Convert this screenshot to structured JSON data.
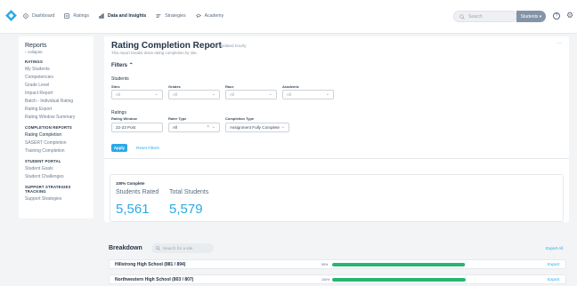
{
  "nav": {
    "items": [
      {
        "label": "Dashboard",
        "icon": "home-icon"
      },
      {
        "label": "Ratings",
        "icon": "ratings-icon"
      },
      {
        "label": "Data and Insights",
        "icon": "chart-icon",
        "active": true
      },
      {
        "label": "Strategies",
        "icon": "strategies-icon"
      },
      {
        "label": "Academy",
        "icon": "academy-icon"
      }
    ],
    "search_placeholder": "Search",
    "students_label": "Students",
    "brand_color": "#2aa9e6"
  },
  "sidebar": {
    "title": "Reports",
    "collapse_label": "collapse",
    "sections": [
      {
        "heading": "RATINGS",
        "items": [
          "My Students",
          "Competencies",
          "Grade Level",
          "Impact Report",
          "Batch - Individual Rating",
          "Rating Export",
          "Rating Window Summary"
        ]
      },
      {
        "heading": "COMPLETION REPORTS",
        "items": [
          "Rating Completion",
          "SASERT Completion",
          "Training Completion"
        ],
        "active": "Rating Completion"
      },
      {
        "heading": "STUDENT PORTAL",
        "items": [
          "Student Goals",
          "Student Challenges"
        ]
      },
      {
        "heading": "SUPPORT STRATEGIES TRACKING",
        "items": [
          "Support Strategies"
        ]
      }
    ]
  },
  "report": {
    "title": "Rating Completion Report",
    "badge": "Data updated hourly",
    "subtitle": "This report breaks down rating completion by site.",
    "filters_label": "Filters",
    "students_group": "Students",
    "sites_label": "Sites",
    "sites_value": "All",
    "grades_label": "Grades",
    "grades_value": "All",
    "race_label": "Race",
    "race_value": "All",
    "academic_label": "Academic",
    "academic_value": "All",
    "ratings_group": "Ratings",
    "window_label": "Rating Window",
    "window_value": "22-23 Post",
    "rater_label": "Rater Type",
    "rater_value": "All",
    "completion_label": "Completion Type",
    "completion_value": "Assignment Fully Complete",
    "apply_label": "Apply",
    "reset_label": "Reset Filters"
  },
  "stats": {
    "heading": "100% Complete",
    "rated_label": "Students Rated",
    "rated_value": "5,561",
    "total_label": "Total Students",
    "total_value": "5,579"
  },
  "breakdown": {
    "title": "Breakdown",
    "search_placeholder": "Search for a site",
    "export_all_label": "Export All",
    "rows": [
      {
        "name": "Hillstrong High School (881 / 894)",
        "pct_label": "99%",
        "fraction": 0.99,
        "export_label": "Export"
      },
      {
        "name": "Northwestern High School (803 / 807)",
        "pct_label": "100%",
        "fraction": 1.0,
        "export_label": "Export"
      }
    ]
  }
}
